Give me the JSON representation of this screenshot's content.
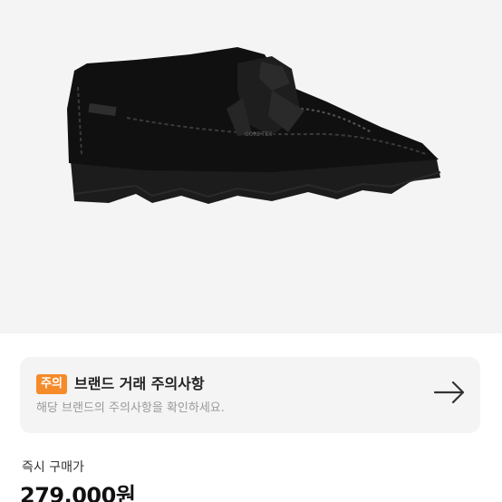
{
  "product": {
    "image_alt": "black suede shoe",
    "shoe_label_text": "GORE-TEX"
  },
  "notice": {
    "badge": "주의",
    "title": "브랜드 거래 주의사항",
    "subtitle": "해당 브랜드의 주의사항을 확인하세요.",
    "arrow_icon": "arrow-right-icon"
  },
  "price": {
    "label": "즉시 구매가",
    "value": "279,000원"
  },
  "colors": {
    "badge": "#f58b2a",
    "card_bg": "#f4f4f4",
    "image_bg": "#f4f4f4"
  }
}
